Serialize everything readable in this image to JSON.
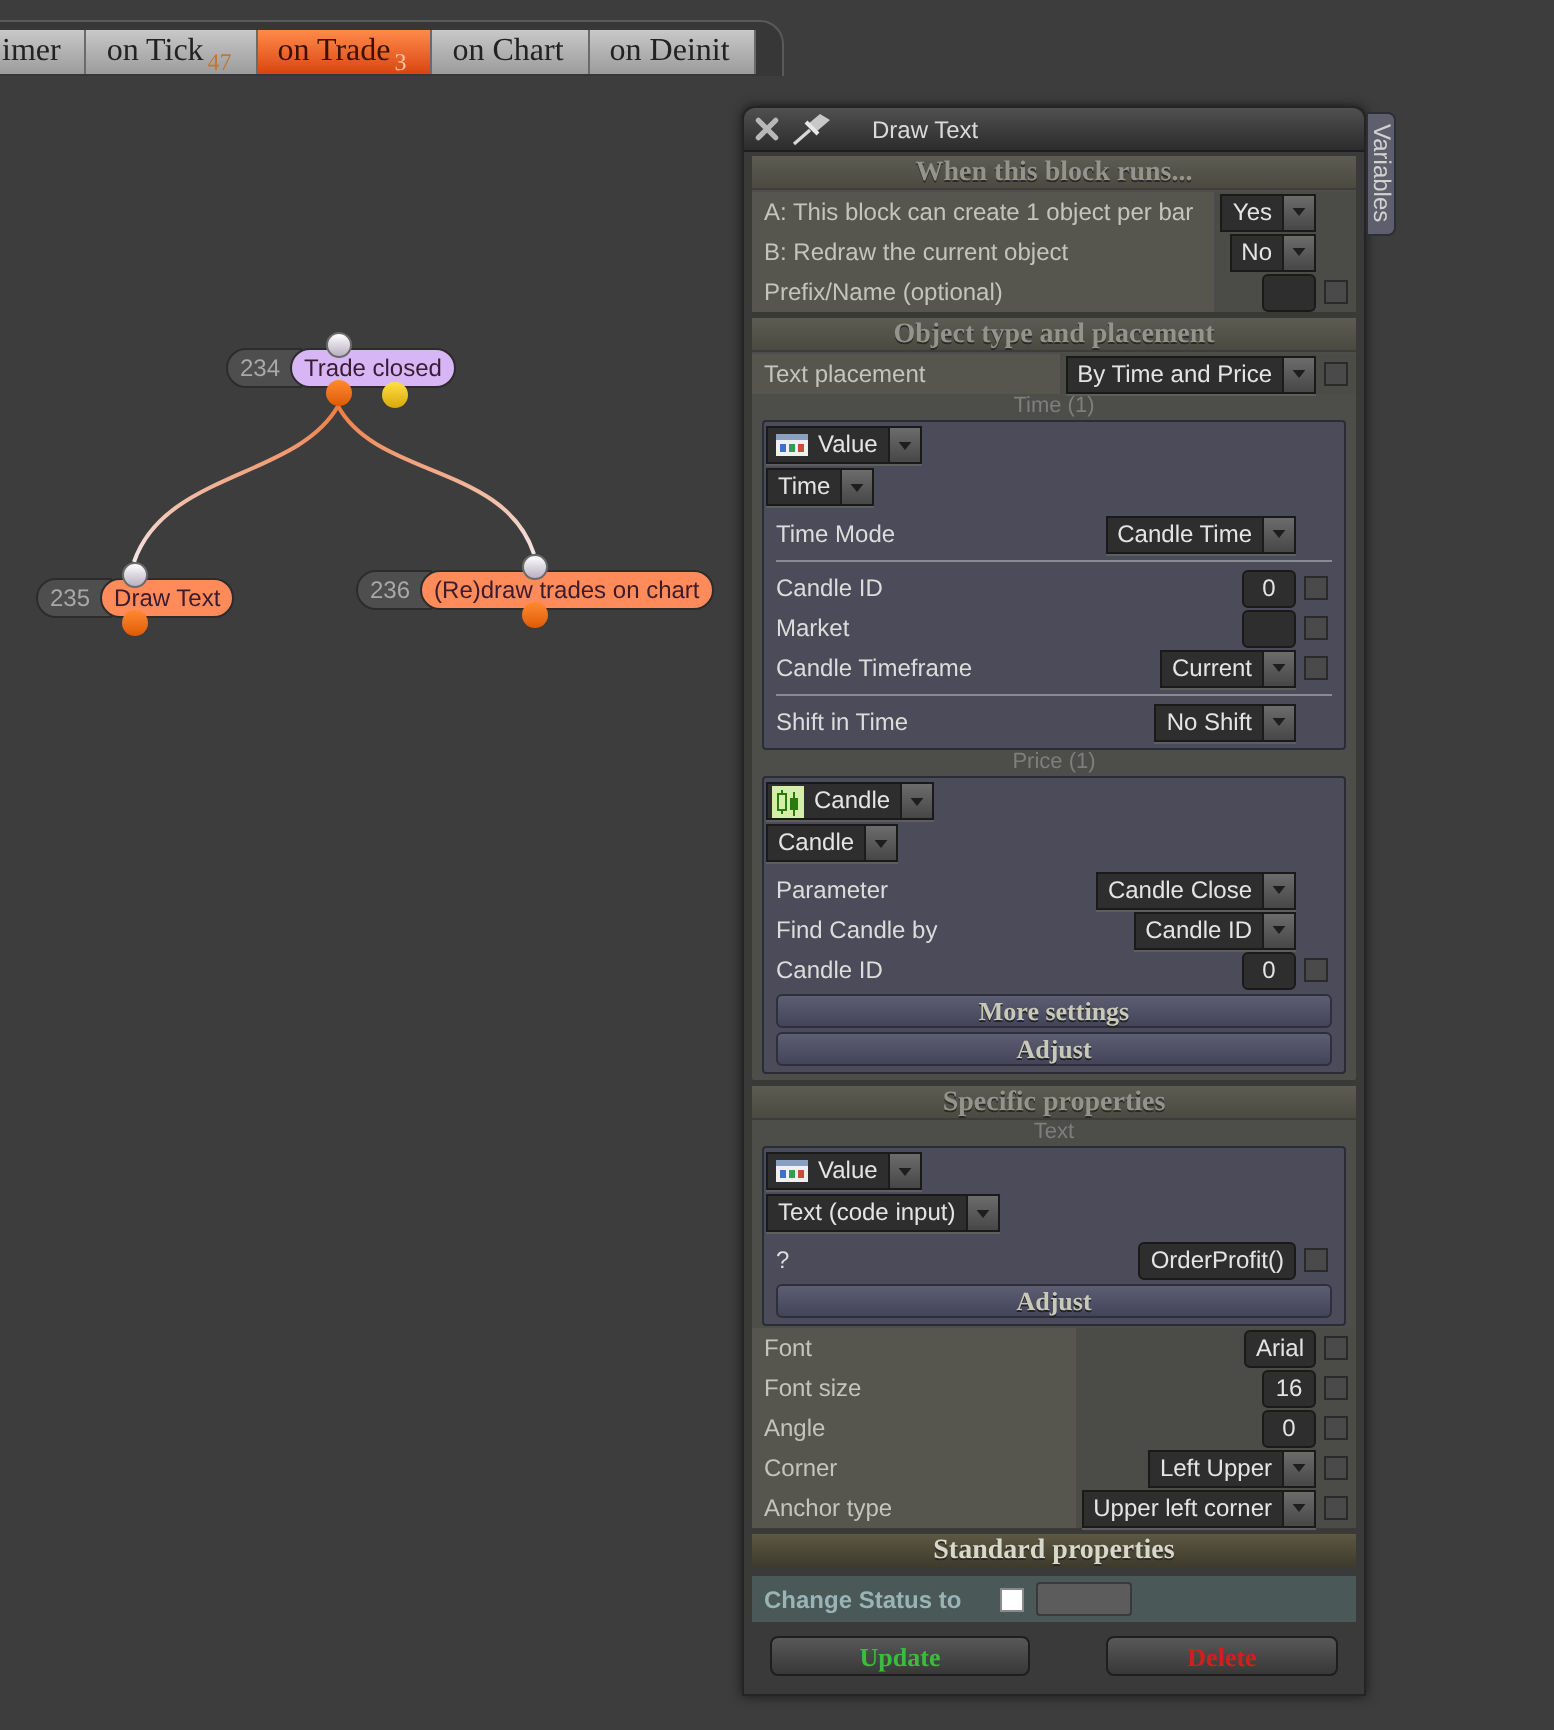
{
  "tabs": [
    {
      "label": "imer",
      "selected": false
    },
    {
      "label": "on Tick",
      "badge": "47",
      "selected": false
    },
    {
      "label": "on Trade",
      "badge": "3",
      "selected": true
    },
    {
      "label": "on Chart",
      "selected": false
    },
    {
      "label": "on Deinit",
      "selected": false
    }
  ],
  "canvas": {
    "nodes": [
      {
        "number": "234",
        "label": "Trade closed",
        "color": "#d8b6f6",
        "children": [
          {
            "number": "235",
            "label": "Draw Text",
            "color": "#ff8a5a"
          },
          {
            "number": "236",
            "label": "(Re)draw trades on chart",
            "color": "#ff8a5a"
          }
        ]
      }
    ]
  },
  "panel": {
    "title": "Draw Text",
    "side_tab": "Variables",
    "sections": [
      {
        "kind": "plain",
        "title": "When this block runs...",
        "items": [
          {
            "kind": "dropdown",
            "label": "A: This block can create 1 object per bar",
            "value": "Yes"
          },
          {
            "kind": "dropdown",
            "label": "B: Redraw the current object",
            "value": "No"
          },
          {
            "kind": "input",
            "label": "Prefix/Name (optional)",
            "checked": false
          }
        ]
      },
      {
        "kind": "plain",
        "title": "Object type and placement",
        "items": [
          {
            "kind": "dropdown",
            "label": "Text placement",
            "value": "By Time and Price",
            "checked": false
          },
          {
            "kind": "group",
            "caption": "Time (1)",
            "selectors": [
              {
                "kind": "value",
                "value": "Value"
              },
              {
                "kind": "plain",
                "value": "Time"
              }
            ],
            "blocks": [
              {
                "rows": [
                  {
                    "kind": "dropdown",
                    "label": "Time Mode",
                    "value": "Candle Time"
                  }
                ]
              },
              {
                "rows": [
                  {
                    "kind": "input",
                    "label": "Candle ID",
                    "value": "0",
                    "checked": false
                  },
                  {
                    "kind": "input",
                    "label": "Market",
                    "checked": false
                  },
                  {
                    "kind": "dropdown",
                    "label": "Candle Timeframe",
                    "value": "Current",
                    "checked": false
                  }
                ]
              },
              {
                "rows": [
                  {
                    "kind": "dropdown",
                    "label": "Shift in Time",
                    "value": "No Shift"
                  }
                ]
              }
            ]
          },
          {
            "kind": "group",
            "caption": "Price (1)",
            "selectors": [
              {
                "kind": "candle",
                "value": "Candle"
              },
              {
                "kind": "plain",
                "value": "Candle"
              }
            ],
            "blocks": [
              {
                "rows": [
                  {
                    "kind": "dropdown",
                    "label": "Parameter",
                    "value": "Candle Close"
                  },
                  {
                    "kind": "dropdown",
                    "label": "Find Candle by",
                    "value": "Candle ID"
                  },
                  {
                    "kind": "input",
                    "label": "Candle ID",
                    "value": "0",
                    "checked": false
                  }
                ]
              }
            ],
            "buttons": [
              "More settings",
              "Adjust"
            ]
          }
        ]
      },
      {
        "kind": "plain",
        "title": "Specific properties",
        "items": [
          {
            "kind": "group",
            "caption": "Text",
            "selectors": [
              {
                "kind": "value",
                "value": "Value"
              },
              {
                "kind": "plain",
                "value": "Text (code input)"
              }
            ],
            "blocks": [
              {
                "rows": [
                  {
                    "kind": "input",
                    "label": "?",
                    "value": "OrderProfit()",
                    "checked": false
                  }
                ]
              }
            ],
            "buttons": [
              "Adjust"
            ]
          },
          {
            "kind": "input",
            "label": "Font",
            "value": "Arial",
            "checked": false
          },
          {
            "kind": "input",
            "label": "Font size",
            "value": "16",
            "checked": false
          },
          {
            "kind": "input",
            "label": "Angle",
            "value": "0",
            "checked": false
          },
          {
            "kind": "dropdown",
            "label": "Corner",
            "value": "Left Upper",
            "checked": false
          },
          {
            "kind": "dropdown",
            "label": "Anchor type",
            "value": "Upper left corner",
            "checked": false
          }
        ]
      },
      {
        "kind": "highlight",
        "title": "Standard properties",
        "items": [
          {
            "kind": "status",
            "label": "Change Status to",
            "checked": false
          }
        ]
      }
    ],
    "buttons": [
      {
        "kind": "confirm",
        "label": "Update"
      },
      {
        "kind": "danger",
        "label": "Delete"
      }
    ]
  }
}
